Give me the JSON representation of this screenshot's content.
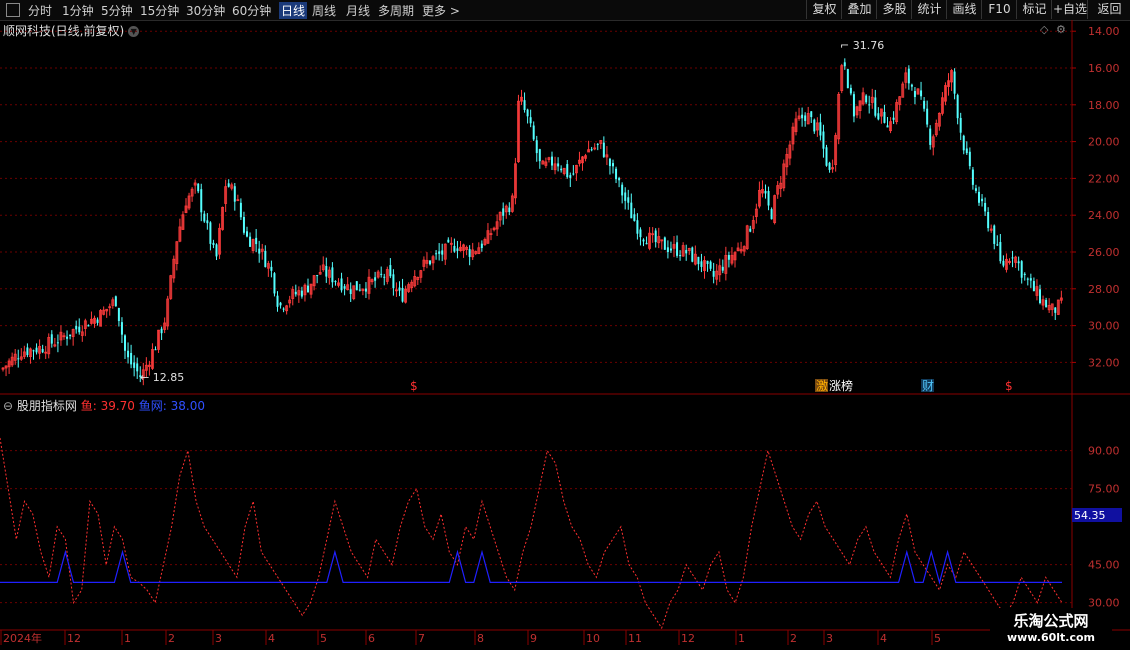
{
  "toolbar": {
    "periods": [
      "分时",
      "1分钟",
      "5分钟",
      "15分钟",
      "30分钟",
      "60分钟",
      "日线",
      "周线",
      "月线",
      "多周期",
      "更多 >"
    ],
    "active": "日线",
    "right": [
      "复权",
      "叠加",
      "多股",
      "统计",
      "画线",
      "F10",
      "标记",
      "+自选",
      "返回"
    ]
  },
  "main": {
    "title": "顺网科技(日线,前复权)",
    "price_ticks": [
      "32.00",
      "30.00",
      "28.00",
      "26.00",
      "24.00",
      "22.00",
      "20.00",
      "18.00",
      "16.00",
      "14.00"
    ],
    "high_label": "31.76",
    "low_label": "12.85",
    "markers": [
      {
        "text": "$",
        "color": "#ff3030"
      },
      {
        "text": "激",
        "color": "#ffb000"
      },
      {
        "text": "涨榜",
        "color": "#ffffff"
      },
      {
        "text": "财",
        "color": "#4fc3f7"
      },
      {
        "text": "$",
        "color": "#ff3030"
      }
    ]
  },
  "indicator": {
    "name": "股朋指标网",
    "series1_label": "鱼: 39.70",
    "series2_label": "鱼网: 38.00",
    "ticks": [
      "90.00",
      "75.00",
      "45.00",
      "30.00"
    ],
    "current_value_label": "54.35"
  },
  "date_axis": [
    "2024年",
    "12",
    "1",
    "2",
    "3",
    "4",
    "5",
    "6",
    "7",
    "8",
    "9",
    "10",
    "11",
    "12",
    "1",
    "2",
    "3",
    "4",
    "5"
  ],
  "watermark": {
    "line1": "乐淘公式网",
    "line2": "www.60lt.com"
  },
  "colors": {
    "up": "#ff3c3c",
    "down": "#54ffff",
    "grid": "#6b0000",
    "line1": "#ff3030",
    "line2": "#2020ff",
    "text": "#c8c8c8"
  },
  "chart_data": [
    {
      "type": "candlestick",
      "ylim": [
        12.5,
        32.5
      ],
      "y_ticks": [
        14,
        16,
        18,
        20,
        22,
        24,
        26,
        28,
        30,
        32
      ],
      "close_path": [
        [
          0,
          13.6
        ],
        [
          20,
          14.6
        ],
        [
          40,
          14.8
        ],
        [
          60,
          15.3
        ],
        [
          80,
          16.0
        ],
        [
          100,
          16.6
        ],
        [
          115,
          17.4
        ],
        [
          125,
          14.3
        ],
        [
          140,
          13.2
        ],
        [
          155,
          15.0
        ],
        [
          165,
          16.5
        ],
        [
          175,
          20.5
        ],
        [
          185,
          22.8
        ],
        [
          195,
          23.5
        ],
        [
          205,
          21.5
        ],
        [
          215,
          19.5
        ],
        [
          225,
          23.8
        ],
        [
          235,
          23.0
        ],
        [
          245,
          20.8
        ],
        [
          255,
          20.5
        ],
        [
          270,
          19.0
        ],
        [
          278,
          17.0
        ],
        [
          290,
          17.6
        ],
        [
          305,
          18.0
        ],
        [
          320,
          19.0
        ],
        [
          335,
          18.5
        ],
        [
          350,
          18.0
        ],
        [
          370,
          18.3
        ],
        [
          385,
          18.8
        ],
        [
          400,
          17.5
        ],
        [
          410,
          18.6
        ],
        [
          425,
          19.4
        ],
        [
          440,
          19.9
        ],
        [
          455,
          20.4
        ],
        [
          470,
          20.0
        ],
        [
          485,
          20.6
        ],
        [
          500,
          22.0
        ],
        [
          512,
          22.8
        ],
        [
          518,
          28.5
        ],
        [
          528,
          27.0
        ],
        [
          540,
          24.5
        ],
        [
          555,
          25.0
        ],
        [
          570,
          24.0
        ],
        [
          585,
          25.5
        ],
        [
          600,
          25.8
        ],
        [
          615,
          24.0
        ],
        [
          628,
          22.3
        ],
        [
          640,
          21.0
        ],
        [
          655,
          20.5
        ],
        [
          670,
          20.2
        ],
        [
          685,
          20.0
        ],
        [
          700,
          19.4
        ],
        [
          712,
          18.6
        ],
        [
          725,
          19.5
        ],
        [
          740,
          20.3
        ],
        [
          750,
          21.5
        ],
        [
          760,
          23.5
        ],
        [
          770,
          22.0
        ],
        [
          782,
          24.5
        ],
        [
          795,
          27.0
        ],
        [
          805,
          27.5
        ],
        [
          818,
          26.5
        ],
        [
          830,
          24.0
        ],
        [
          842,
          31.0
        ],
        [
          852,
          27.5
        ],
        [
          865,
          28.5
        ],
        [
          878,
          27.5
        ],
        [
          890,
          27.0
        ],
        [
          905,
          29.5
        ],
        [
          918,
          28.5
        ],
        [
          930,
          26.0
        ],
        [
          940,
          28.0
        ],
        [
          950,
          29.8
        ],
        [
          960,
          26.5
        ],
        [
          970,
          24.0
        ],
        [
          980,
          22.5
        ],
        [
          992,
          21.0
        ],
        [
          1000,
          19.2
        ],
        [
          1012,
          20.0
        ],
        [
          1022,
          18.8
        ],
        [
          1032,
          18.0
        ],
        [
          1042,
          17.3
        ],
        [
          1052,
          16.8
        ],
        [
          1062,
          17.2
        ]
      ],
      "high": 31.76,
      "low": 12.85
    },
    {
      "type": "line",
      "ylim": [
        20,
        110
      ],
      "y_ticks": [
        30,
        45,
        75,
        90
      ],
      "series": [
        {
          "name": "鱼",
          "values": [
            95,
            75,
            55,
            70,
            65,
            50,
            40,
            60,
            55,
            30,
            35,
            70,
            65,
            45,
            60,
            55,
            40,
            38,
            35,
            30,
            45,
            60,
            80,
            90,
            70,
            60,
            55,
            50,
            45,
            40,
            60,
            70,
            50,
            45,
            40,
            35,
            30,
            25,
            30,
            40,
            55,
            70,
            60,
            50,
            45,
            40,
            55,
            50,
            45,
            60,
            70,
            75,
            60,
            55,
            65,
            50,
            45,
            60,
            55,
            70,
            60,
            50,
            40,
            35,
            50,
            60,
            75,
            90,
            85,
            70,
            60,
            55,
            45,
            40,
            50,
            55,
            60,
            45,
            40,
            30,
            25,
            20,
            30,
            35,
            45,
            40,
            35,
            45,
            50,
            35,
            30,
            40,
            60,
            75,
            90,
            80,
            70,
            60,
            55,
            65,
            70,
            60,
            55,
            50,
            45,
            55,
            60,
            50,
            45,
            40,
            55,
            65,
            50,
            45,
            40,
            35,
            45,
            40,
            50,
            45,
            40,
            35,
            30,
            25,
            30,
            40,
            35,
            30,
            40,
            35,
            30
          ]
        },
        {
          "name": "鱼网",
          "values": [
            38,
            38,
            38,
            38,
            38,
            38,
            38,
            38,
            50,
            38,
            38,
            38,
            38,
            38,
            38,
            50,
            38,
            38,
            38,
            38,
            38,
            38,
            38,
            38,
            38,
            38,
            38,
            38,
            38,
            38,
            38,
            38,
            38,
            38,
            38,
            38,
            38,
            38,
            38,
            38,
            38,
            50,
            38,
            38,
            38,
            38,
            38,
            38,
            38,
            38,
            38,
            38,
            38,
            38,
            38,
            38,
            50,
            38,
            38,
            50,
            38,
            38,
            38,
            38,
            38,
            38,
            38,
            38,
            38,
            38,
            38,
            38,
            38,
            38,
            38,
            38,
            38,
            38,
            38,
            38,
            38,
            38,
            38,
            38,
            38,
            38,
            38,
            38,
            38,
            38,
            38,
            38,
            38,
            38,
            38,
            38,
            38,
            38,
            38,
            38,
            38,
            38,
            38,
            38,
            38,
            38,
            38,
            38,
            38,
            38,
            38,
            50,
            38,
            38,
            50,
            38,
            50,
            38,
            38,
            38,
            38,
            38,
            38,
            38,
            38,
            38,
            38,
            38,
            38,
            38,
            38
          ]
        }
      ]
    }
  ]
}
